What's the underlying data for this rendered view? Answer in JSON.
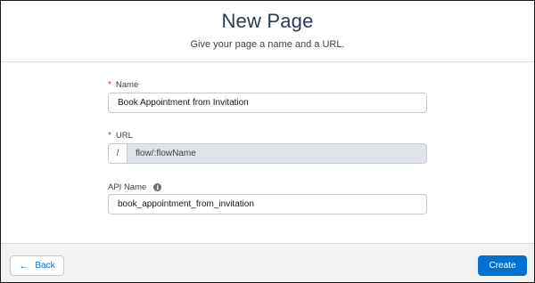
{
  "header": {
    "title": "New Page",
    "subtitle": "Give your page a name and a URL."
  },
  "form": {
    "name": {
      "required_marker": "*",
      "label": "Name",
      "value": "Book Appointment from Invitation"
    },
    "url": {
      "required_marker": "*",
      "label": "URL",
      "prefix": "/",
      "value": "flow/:flowName"
    },
    "api_name": {
      "label": "API Name",
      "info_icon_glyph": "i",
      "value": "book_appointment_from_invitation"
    }
  },
  "footer": {
    "back_icon": "←",
    "back_label": "Back",
    "create_label": "Create"
  },
  "colors": {
    "primary": "#0070d2",
    "required": "#c23934",
    "readonly_field": "#dfe3ea",
    "footer_bg": "#f3f2f2"
  },
  "icons": {
    "back": "arrow-left-icon",
    "info": "info-icon"
  }
}
